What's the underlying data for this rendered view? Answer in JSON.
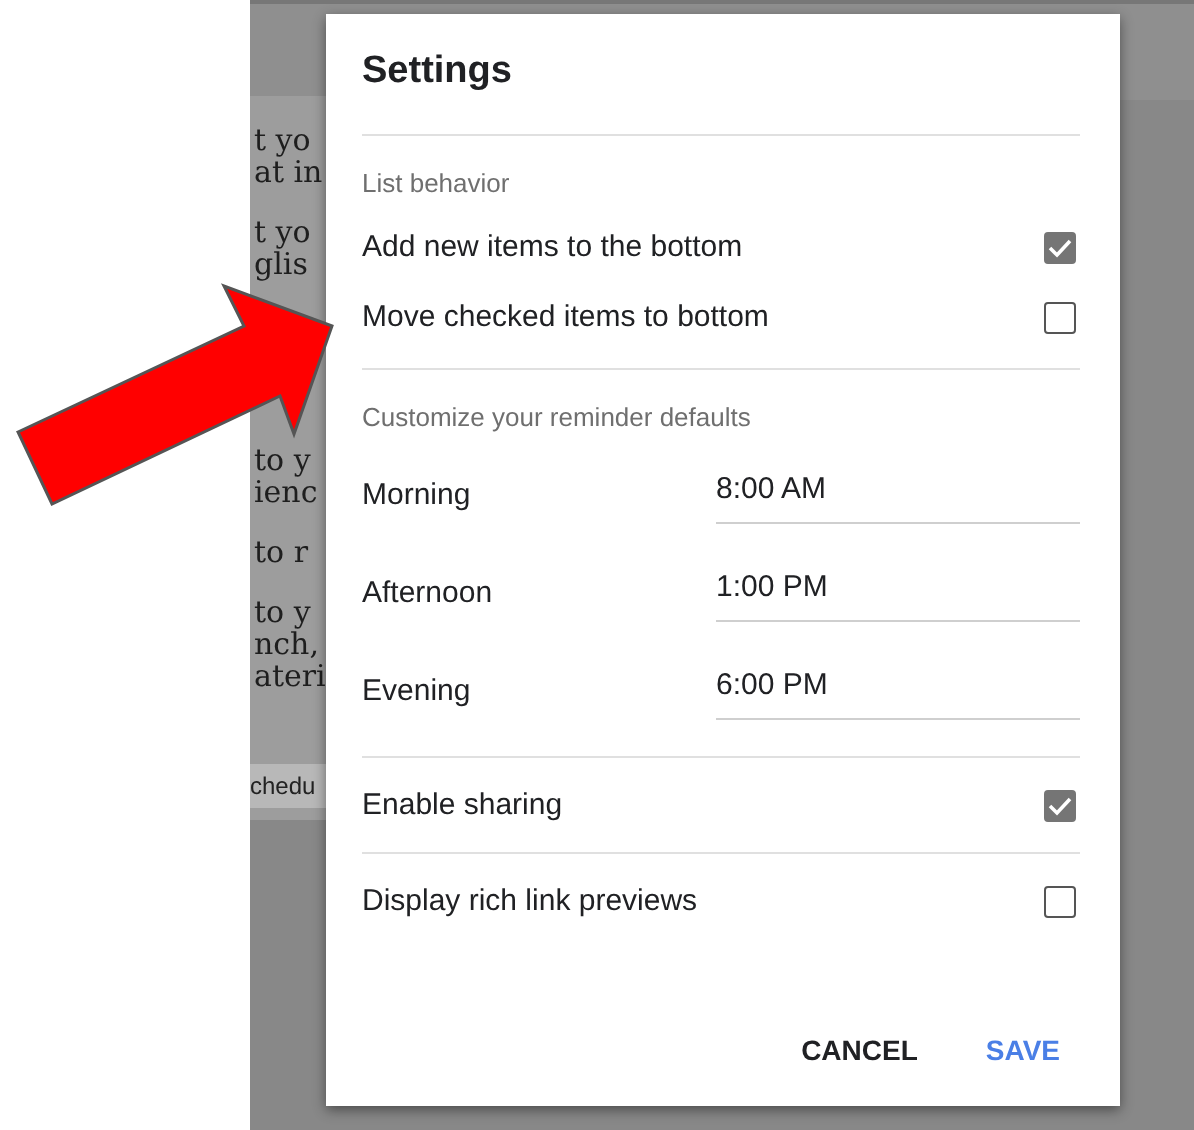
{
  "background_page": {
    "paragraphs": [
      [
        "t yo",
        "at in"
      ],
      [
        "t yo",
        "glis"
      ],
      [
        "to y",
        "ienc"
      ],
      [
        "to r"
      ],
      [
        "to y",
        "nch,",
        "ateri"
      ]
    ],
    "button_fragment": "chedu"
  },
  "dialog": {
    "title": "Settings",
    "sections": [
      {
        "heading": "List behavior",
        "items": [
          {
            "kind": "checkbox",
            "label": "Add new items to the bottom",
            "checked": true
          },
          {
            "kind": "checkbox",
            "label": "Move checked items to bottom",
            "checked": false
          }
        ]
      },
      {
        "heading": "Customize your reminder defaults",
        "items": [
          {
            "kind": "time",
            "label": "Morning",
            "value": "8:00 AM"
          },
          {
            "kind": "time",
            "label": "Afternoon",
            "value": "1:00 PM"
          },
          {
            "kind": "time",
            "label": "Evening",
            "value": "6:00 PM"
          }
        ]
      },
      {
        "items": [
          {
            "kind": "checkbox",
            "label": "Enable sharing",
            "checked": true
          }
        ]
      },
      {
        "items": [
          {
            "kind": "checkbox",
            "label": "Display rich link previews",
            "checked": false
          }
        ]
      }
    ],
    "buttons": [
      {
        "kind": "text",
        "label": "CANCEL"
      },
      {
        "kind": "primary",
        "label": "SAVE"
      }
    ]
  }
}
